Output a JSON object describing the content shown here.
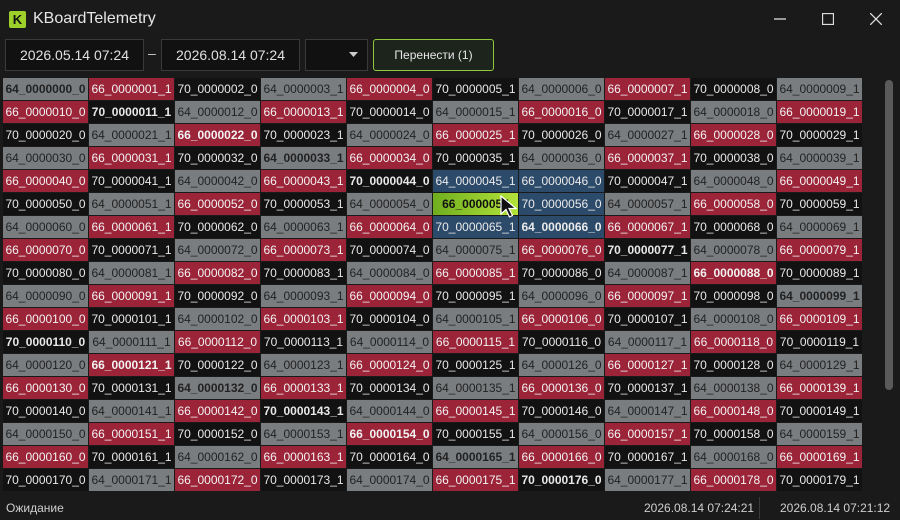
{
  "window": {
    "logo_letter": "K",
    "title": "KBoardTelemetry"
  },
  "toolbar": {
    "date_from": "2026.05.14 07:24",
    "date_sep": "–",
    "date_to": "2026.08.14 07:24",
    "dropdown_value": "",
    "move_label": "Перенести (1)"
  },
  "grid": {
    "columns": 10,
    "rows": 18,
    "cells": [
      "64_0000000_0",
      "66_0000001_1",
      "70_0000002_0",
      "64_0000003_1",
      "66_0000004_0",
      "70_0000005_1",
      "64_0000006_0",
      "66_0000007_1",
      "70_0000008_0",
      "64_0000009_1",
      "66_0000010_0",
      "70_0000011_1",
      "64_0000012_0",
      "66_0000013_1",
      "70_0000014_0",
      "64_0000015_1",
      "66_0000016_0",
      "70_0000017_1",
      "64_0000018_0",
      "66_0000019_1",
      "70_0000020_0",
      "64_0000021_1",
      "66_0000022_0",
      "70_0000023_1",
      "64_0000024_0",
      "66_0000025_1",
      "70_0000026_0",
      "64_0000027_1",
      "66_0000028_0",
      "70_0000029_1",
      "64_0000030_0",
      "66_0000031_1",
      "70_0000032_0",
      "64_0000033_1",
      "66_0000034_0",
      "70_0000035_1",
      "64_0000036_0",
      "66_0000037_1",
      "70_0000038_0",
      "64_0000039_1",
      "66_0000040_0",
      "70_0000041_1",
      "64_0000042_0",
      "66_0000043_1",
      "70_0000044_0",
      "64_0000045_1",
      "66_0000046_0",
      "70_0000047_1",
      "64_0000048_0",
      "66_0000049_1",
      "70_0000050_0",
      "64_0000051_1",
      "66_0000052_0",
      "70_0000053_1",
      "64_0000054_0",
      "66_0000055",
      "70_0000056_0",
      "64_0000057_1",
      "66_0000058_0",
      "70_0000059_1",
      "64_0000060_0",
      "66_0000061_1",
      "70_0000062_0",
      "64_0000063_1",
      "66_0000064_0",
      "70_0000065_1",
      "64_0000066_0",
      "66_0000067_1",
      "70_0000068_0",
      "64_0000069_1",
      "66_0000070_0",
      "70_0000071_1",
      "64_0000072_0",
      "66_0000073_1",
      "70_0000074_0",
      "64_0000075_1",
      "66_0000076_0",
      "70_0000077_1",
      "64_0000078_0",
      "66_0000079_1",
      "70_0000080_0",
      "64_0000081_1",
      "66_0000082_0",
      "70_0000083_1",
      "64_0000084_0",
      "66_0000085_1",
      "70_0000086_0",
      "64_0000087_1",
      "66_0000088_0",
      "70_0000089_1",
      "64_0000090_0",
      "66_0000091_1",
      "70_0000092_0",
      "64_0000093_1",
      "66_0000094_0",
      "70_0000095_1",
      "64_0000096_0",
      "66_0000097_1",
      "70_0000098_0",
      "64_0000099_1",
      "66_0000100_0",
      "70_0000101_1",
      "64_0000102_0",
      "66_0000103_1",
      "70_0000104_0",
      "64_0000105_1",
      "66_0000106_0",
      "70_0000107_1",
      "64_0000108_0",
      "66_0000109_1",
      "70_0000110_0",
      "64_0000111_1",
      "66_0000112_0",
      "70_0000113_1",
      "64_0000114_0",
      "66_0000115_1",
      "70_0000116_0",
      "64_0000117_1",
      "66_0000118_0",
      "70_0000119_1",
      "64_0000120_0",
      "66_0000121_1",
      "70_0000122_0",
      "64_0000123_1",
      "66_0000124_0",
      "70_0000125_1",
      "64_0000126_0",
      "66_0000127_1",
      "70_0000128_0",
      "64_0000129_1",
      "66_0000130_0",
      "70_0000131_1",
      "64_0000132_0",
      "66_0000133_1",
      "70_0000134_0",
      "64_0000135_1",
      "66_0000136_0",
      "70_0000137_1",
      "64_0000138_0",
      "66_0000139_1",
      "70_0000140_0",
      "64_0000141_1",
      "66_0000142_0",
      "70_0000143_1",
      "64_0000144_0",
      "66_0000145_1",
      "70_0000146_0",
      "64_0000147_1",
      "66_0000148_0",
      "70_0000149_1",
      "64_0000150_0",
      "66_0000151_1",
      "70_0000152_0",
      "64_0000153_1",
      "66_0000154_0",
      "70_0000155_1",
      "64_0000156_0",
      "66_0000157_1",
      "70_0000158_0",
      "64_0000159_1",
      "66_0000160_0",
      "70_0000161_1",
      "64_0000162_0",
      "66_0000163_1",
      "70_0000164_0",
      "64_0000165_1",
      "66_0000166_0",
      "70_0000167_1",
      "64_0000168_0",
      "66_0000169_1",
      "70_0000170_0",
      "64_0000171_1",
      "66_0000172_0",
      "70_0000173_1",
      "64_0000174_0",
      "66_0000175_1",
      "70_0000176_0",
      "64_0000177_1",
      "66_0000178_0",
      "70_0000179_1"
    ],
    "bold_indices": [
      0,
      11,
      22,
      33,
      44,
      55,
      66,
      77,
      88,
      99,
      110,
      121,
      132,
      143,
      154,
      165,
      176
    ],
    "selected_index": 55,
    "hover_indices": [
      45,
      46,
      56,
      65,
      66
    ],
    "colors": {
      "prefix_64": "#7a7d80",
      "prefix_66": "#9b2438",
      "prefix_70": "#121212",
      "selected": "#9ed02b"
    }
  },
  "status": {
    "state": "Ожидание",
    "timestamp_1": "2026.08.14 07:24:21",
    "timestamp_2": "2026.08.14 07:21:12"
  }
}
